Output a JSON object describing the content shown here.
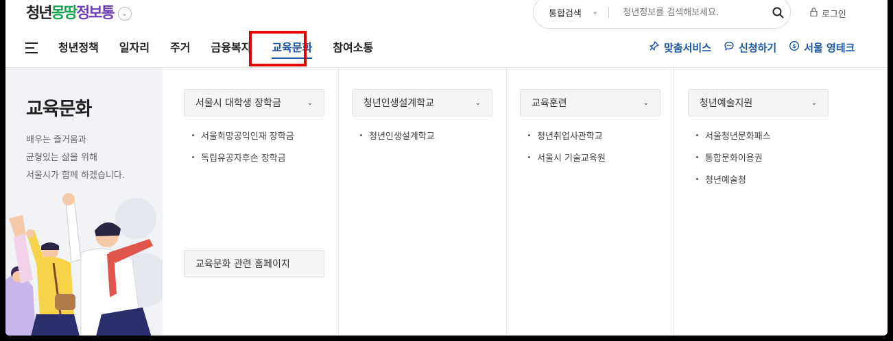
{
  "header": {
    "logo": {
      "part1": "청년",
      "part2": "몽땅",
      "part3": "정보통"
    },
    "search": {
      "category": "통합검색",
      "placeholder": "청년정보를 검색해보세요."
    },
    "login_label": "로그인"
  },
  "nav": {
    "items": [
      {
        "label": "청년정책"
      },
      {
        "label": "일자리"
      },
      {
        "label": "주거"
      },
      {
        "label": "금융복지"
      },
      {
        "label": "교육문화",
        "active": true
      },
      {
        "label": "참여소통"
      }
    ],
    "utility": [
      {
        "label": "맞춤서비스",
        "icon": "pin-icon"
      },
      {
        "label": "신청하기",
        "icon": "chat-icon"
      },
      {
        "label": "서울 영테크",
        "icon": "coin-icon"
      }
    ],
    "highlight_color": "#e10000",
    "accent_color": "#1a56a8"
  },
  "left_panel": {
    "title": "교육문화",
    "desc_lines": [
      "배우는 즐거움과",
      "균형있는 삶을 위해",
      "서울시가 함께 하겠습니다."
    ]
  },
  "menu": {
    "columns": [
      {
        "head": "서울시 대학생 장학금",
        "items": [
          "서울희망공익인재 장학금",
          "독립유공자후손 장학금"
        ],
        "homepage_button": "교육문화 관련 홈페이지"
      },
      {
        "head": "청년인생설계학교",
        "items": [
          "청년인생설계학교"
        ]
      },
      {
        "head": "교육훈련",
        "items": [
          "청년취업사관학교",
          "서울시 기술교육원"
        ]
      },
      {
        "head": "청년예술지원",
        "items": [
          "서울청년문화패스",
          "통합문화이용권",
          "청년예술청"
        ]
      }
    ]
  }
}
